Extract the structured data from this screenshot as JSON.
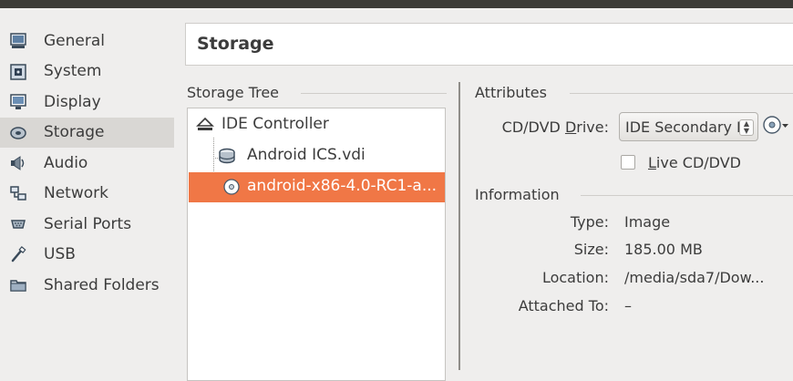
{
  "nav": {
    "items": [
      {
        "label": "General",
        "icon": "monitor-icon"
      },
      {
        "label": "System",
        "icon": "chip-icon"
      },
      {
        "label": "Display",
        "icon": "display-icon"
      },
      {
        "label": "Storage",
        "icon": "disk-icon",
        "selected": true
      },
      {
        "label": "Audio",
        "icon": "speaker-icon"
      },
      {
        "label": "Network",
        "icon": "network-icon"
      },
      {
        "label": "Serial Ports",
        "icon": "serial-port-icon"
      },
      {
        "label": "USB",
        "icon": "usb-icon"
      },
      {
        "label": "Shared Folders",
        "icon": "folder-icon"
      }
    ]
  },
  "header": {
    "title": "Storage"
  },
  "storage_tree": {
    "title": "Storage Tree",
    "controller": "IDE Controller",
    "items": [
      {
        "label": "Android ICS.vdi",
        "icon": "hard-disk-icon"
      },
      {
        "label": "android-x86-4.0-RC1-a...",
        "icon": "optical-disc-icon",
        "selected": true
      }
    ]
  },
  "attributes": {
    "title": "Attributes",
    "cd_drive_label_pre": "CD/DVD ",
    "cd_drive_label_u": "D",
    "cd_drive_label_post": "rive:",
    "cd_drive_value": "IDE Secondary Master",
    "live_cd_u": "L",
    "live_cd_rest": "ive CD/DVD",
    "live_cd_checked": false
  },
  "information": {
    "title": "Information",
    "rows": [
      {
        "label": "Type:",
        "value": "Image"
      },
      {
        "label": "Size:",
        "value": "185.00 MB"
      },
      {
        "label": "Location:",
        "value": "/media/sda7/Dow..."
      },
      {
        "label": "Attached To:",
        "value": "–"
      }
    ]
  },
  "colors": {
    "selection": "#f07746",
    "nav_selected": "#d9d7d4",
    "background": "#efeeed"
  }
}
